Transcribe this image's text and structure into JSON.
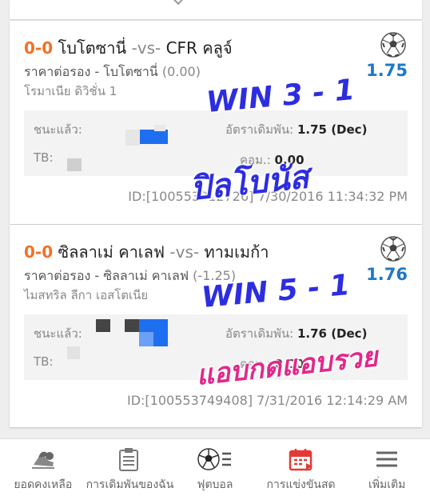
{
  "bets": [
    {
      "score": "0-0",
      "home": "โบโตซานี่",
      "vs": "-vs-",
      "away": "CFR คลูจ์",
      "market": "ราคาต่อรอง - โบโตซานี่",
      "handicap": "(0.00)",
      "league": "โรมาเนีย ดิวิชั่น 1",
      "odds": "1.75",
      "status_label": "ชนะแล้ว:",
      "odds_label": "อัตราเดิมพัน:",
      "odds_value": "1.75 (Dec)",
      "tb_label": "TB:",
      "commission_label": "คอม.:",
      "commission_value": "0.00",
      "id_text": "ID:[100553312726]",
      "datetime": "7/30/2016 11:34:32 PM"
    },
    {
      "score": "0-0",
      "home": "ซิลลาเม่ คาเลฟ",
      "vs": "-vs-",
      "away": "ทามเมก้า",
      "market": "ราคาต่อรอง - ซิลลาเม่ คาเลฟ",
      "handicap": "(-1.25)",
      "league": "ไมสทริล ลีกา เอสโตเนีย",
      "odds": "1.76",
      "status_label": "ชนะแล้ว:",
      "odds_label": "อัตราเดิมพัน:",
      "odds_value": "1.76 (Dec)",
      "tb_label": "TB:",
      "commission_label": "คอม.:",
      "commission_value": "0.00",
      "id_text": "ID:[100553749408]",
      "datetime": "7/31/2016 12:14:29 AM"
    }
  ],
  "overlays": {
    "win1": "WIN 3 - 1",
    "bonus": "ปิลโบนัส",
    "win2": "WIN 5 - 1",
    "rich": "แอบกดแอบรวย"
  },
  "nav": [
    {
      "label": "ยอดคงเหลือ",
      "icon": "balance-icon"
    },
    {
      "label": "การเดิมพันของฉัน",
      "icon": "clipboard-icon"
    },
    {
      "label": "ฟุตบอล",
      "icon": "football-list-icon"
    },
    {
      "label": "การแข่งขันสด",
      "icon": "calendar-icon"
    },
    {
      "label": "เพิ่มเติม",
      "icon": "menu-icon"
    }
  ],
  "colors": {
    "score": "#f37024",
    "odds": "#1f78c4",
    "overlay_blue": "#2d2de0",
    "overlay_pink": "#e0298c",
    "calendar_red": "#e53935"
  }
}
